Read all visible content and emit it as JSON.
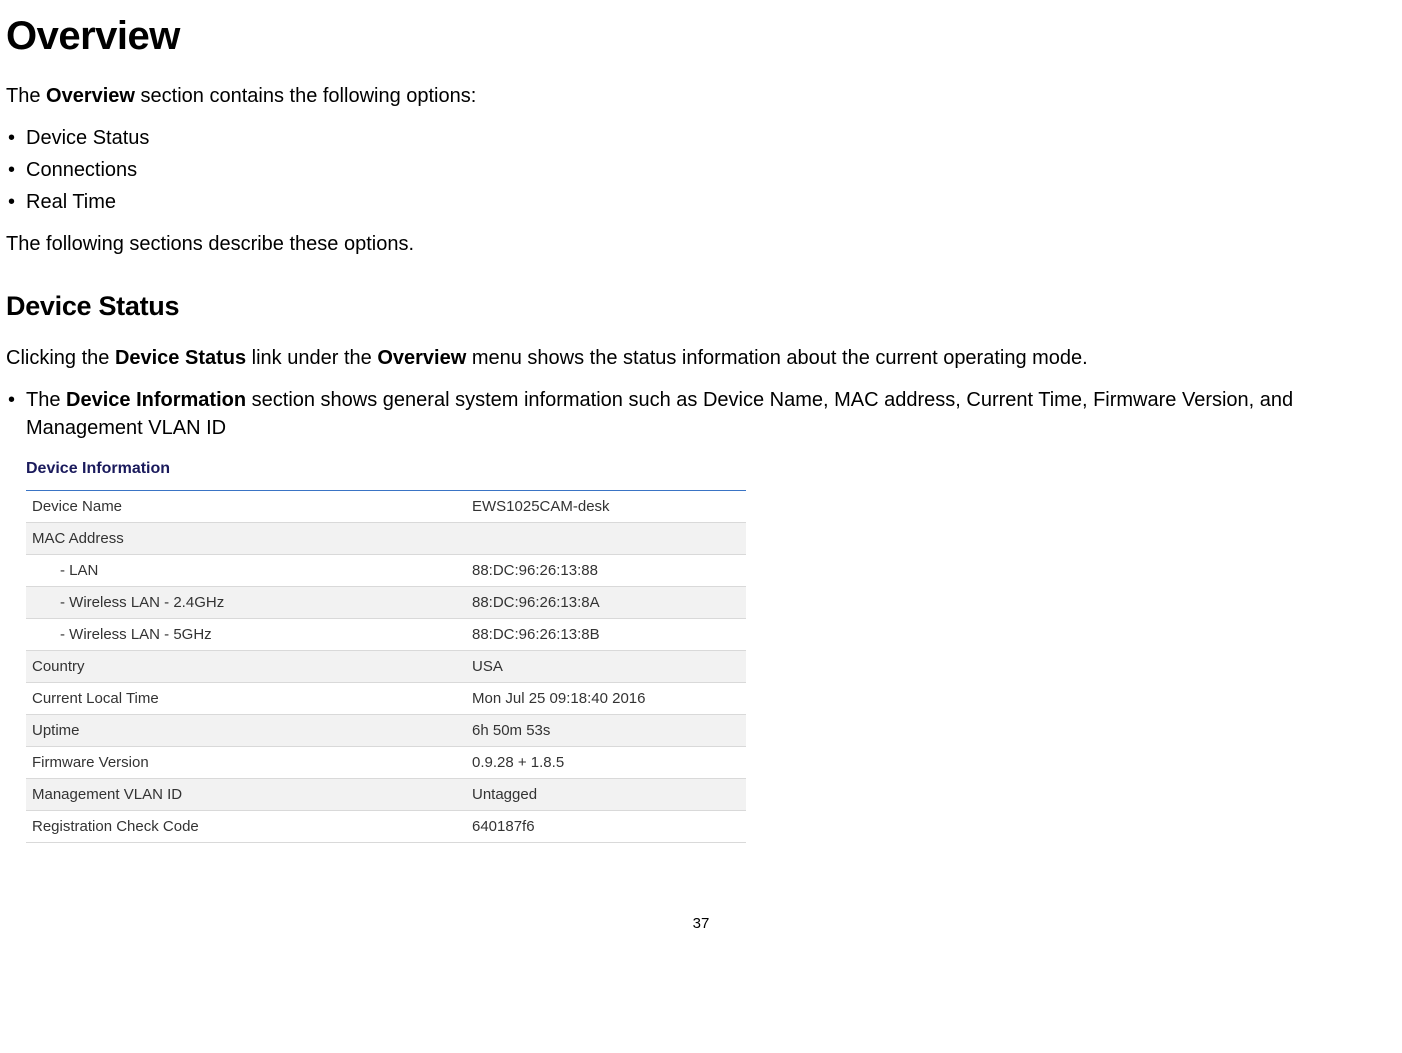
{
  "heading": "Overview",
  "intro_pre": "The ",
  "intro_bold": "Overview",
  "intro_post": " section contains the following options:",
  "options": [
    "Device Status",
    "Connections",
    "Real Time"
  ],
  "options_followup": "The following sections describe these options.",
  "section_heading": "Device Status",
  "ds_para_pre": "Clicking the ",
  "ds_para_b1": "Device Status",
  "ds_para_mid": " link under the ",
  "ds_para_b2": "Overview",
  "ds_para_post": " menu shows the status information about the current operating mode.",
  "ds_bullet_pre": "The ",
  "ds_bullet_bold": "Device Information",
  "ds_bullet_post": " section shows general system information such as Device Name, MAC address, Current Time, Firmware Version, and Management VLAN ID",
  "table_title": "Device Information",
  "rows": [
    {
      "label": "Device Name",
      "value": "EWS1025CAM-desk",
      "alt": false,
      "sub": false
    },
    {
      "label": "MAC Address",
      "value": "",
      "alt": true,
      "sub": false
    },
    {
      "label": "- LAN",
      "value": "88:DC:96:26:13:88",
      "alt": false,
      "sub": true
    },
    {
      "label": "- Wireless LAN - 2.4GHz",
      "value": "88:DC:96:26:13:8A",
      "alt": true,
      "sub": true
    },
    {
      "label": "- Wireless LAN - 5GHz",
      "value": "88:DC:96:26:13:8B",
      "alt": false,
      "sub": true
    },
    {
      "label": "Country",
      "value": "USA",
      "alt": true,
      "sub": false
    },
    {
      "label": "Current Local Time",
      "value": "Mon Jul 25 09:18:40 2016",
      "alt": false,
      "sub": false
    },
    {
      "label": "Uptime",
      "value": "6h 50m 53s",
      "alt": true,
      "sub": false
    },
    {
      "label": "Firmware Version",
      "value": "0.9.28 + 1.8.5",
      "alt": false,
      "sub": false
    },
    {
      "label": "Management VLAN ID",
      "value": "Untagged",
      "alt": true,
      "sub": false
    },
    {
      "label": "Registration Check Code",
      "value": "640187f6",
      "alt": false,
      "sub": false
    }
  ],
  "page_number": "37"
}
